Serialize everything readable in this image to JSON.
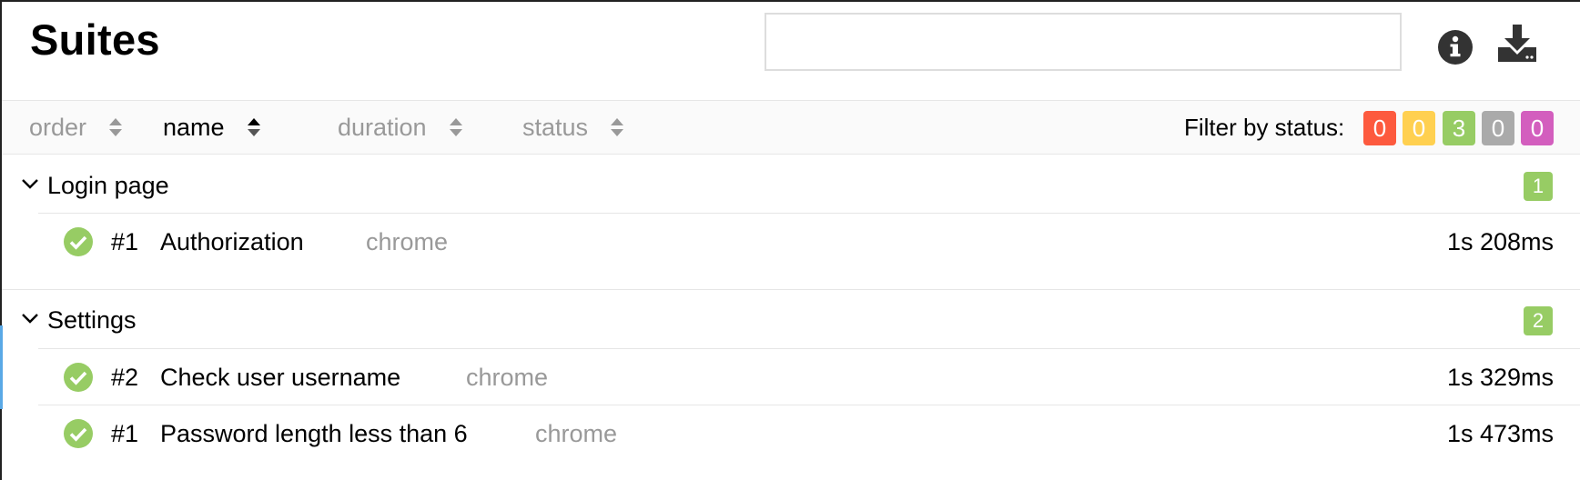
{
  "header": {
    "title": "Suites",
    "search_value": "",
    "info_icon": "info-circle-icon",
    "download_icon": "download-icon"
  },
  "sort": [
    {
      "label": "order",
      "active": false
    },
    {
      "label": "name",
      "active": true
    },
    {
      "label": "duration",
      "active": false
    },
    {
      "label": "status",
      "active": false
    }
  ],
  "filter": {
    "label": "Filter by status:",
    "badges": [
      {
        "status": "failed",
        "count": "0",
        "color": "#fd5a3e"
      },
      {
        "status": "broken",
        "count": "0",
        "color": "#ffd050"
      },
      {
        "status": "passed",
        "count": "3",
        "color": "#97cc64"
      },
      {
        "status": "skipped",
        "count": "0",
        "color": "#aaaaaa"
      },
      {
        "status": "unknown",
        "count": "0",
        "color": "#d35ebe"
      }
    ]
  },
  "groups": [
    {
      "title": "Login page",
      "count": "1",
      "tests": [
        {
          "num": "#1",
          "name": "Authorization",
          "param": "chrome",
          "duration": "1s 208ms",
          "status": "passed"
        }
      ]
    },
    {
      "title": "Settings",
      "count": "2",
      "tests": [
        {
          "num": "#2",
          "name": "Check user username",
          "param": "chrome",
          "duration": "1s 329ms",
          "status": "passed"
        },
        {
          "num": "#1",
          "name": "Password length less than 6",
          "param": "chrome",
          "duration": "1s 473ms",
          "status": "passed"
        }
      ]
    }
  ],
  "colors": {
    "passed": "#97cc64",
    "accent": "#5aa9e6"
  }
}
